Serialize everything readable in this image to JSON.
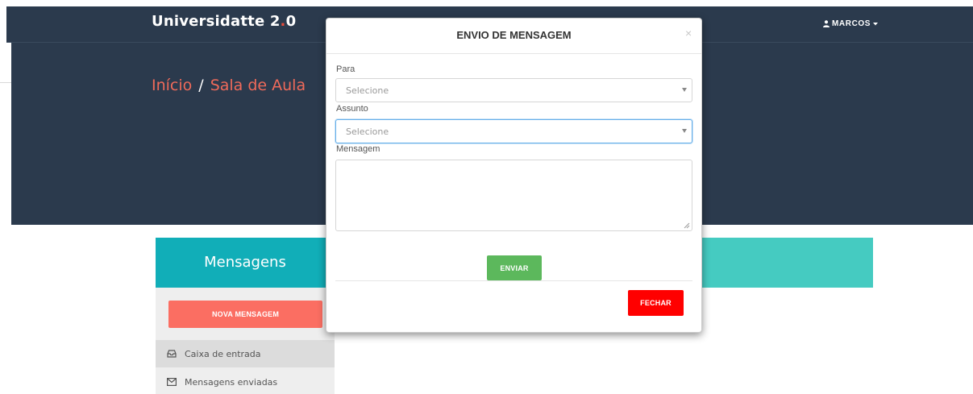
{
  "navbar": {
    "brand_main": "Universidatte 2",
    "brand_dot": ".",
    "brand_tail": "0",
    "user_label": "MARCOS",
    "user_icon": "user-icon",
    "caret_icon": "caret-down-icon"
  },
  "hero": {
    "breadcrumb_home": "Início",
    "breadcrumb_sep": "/",
    "breadcrumb_current": "Sala de Aula"
  },
  "messages_panel": {
    "title": "Mensagens",
    "new_message_label": "NOVA MENSAGEM",
    "items": [
      {
        "label": "Caixa de entrada",
        "icon": "inbox-icon",
        "active": true
      },
      {
        "label": "Mensagens enviadas",
        "icon": "envelope-icon",
        "active": false
      }
    ]
  },
  "modal": {
    "title": "ENVIO DE MENSAGEM",
    "close_symbol": "×",
    "to_label": "Para",
    "to_value": "Selecione",
    "subject_label": "Assunto",
    "subject_value": "Selecione",
    "message_label": "Mensagem",
    "message_value": "",
    "send_label": "ENVIAR",
    "close_label": "FECHAR"
  },
  "colors": {
    "navbar_bg": "#2b3a4d",
    "brand_accent": "#e74c3c",
    "breadcrumb": "#ef6a5a",
    "panel_header": "#11aeb8",
    "panel_header_right": "#45cbc1",
    "new_message_button": "#fb6e62",
    "send_button": "#5cb85c",
    "close_button": "#ff0000"
  }
}
